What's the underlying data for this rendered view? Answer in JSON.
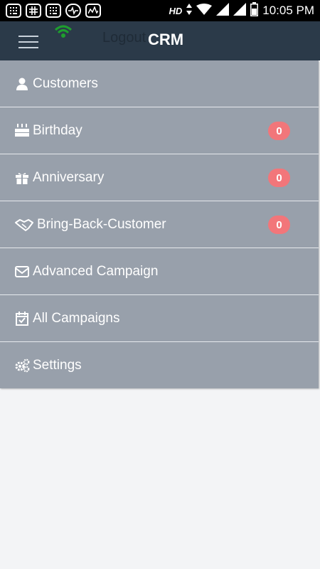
{
  "status_bar": {
    "network_type": "HD",
    "time": "10:05 PM",
    "notification_icons": [
      "calculator-icon",
      "slack-icon",
      "calculator-icon",
      "pulse-icon",
      "chart-icon"
    ]
  },
  "toolbar": {
    "title": "CRM",
    "logout_label": "Logout",
    "wifi_color": "#1e9e2e",
    "background_color": "#2b3a49"
  },
  "drawer": {
    "background_color": "#98a0ab",
    "badge_color": "#f2767a",
    "items": [
      {
        "label": "Customers",
        "icon": "person-icon"
      },
      {
        "label": "Birthday",
        "icon": "cake-icon",
        "badge": "0"
      },
      {
        "label": "Anniversary",
        "icon": "gift-icon",
        "badge": "0"
      },
      {
        "label": "Bring-Back-Customer",
        "icon": "handshake-icon",
        "badge": "0"
      },
      {
        "label": "Advanced Campaign",
        "icon": "envelope-icon"
      },
      {
        "label": "All Campaigns",
        "icon": "calendar-check-icon"
      },
      {
        "label": "Settings",
        "icon": "gears-icon"
      }
    ]
  }
}
